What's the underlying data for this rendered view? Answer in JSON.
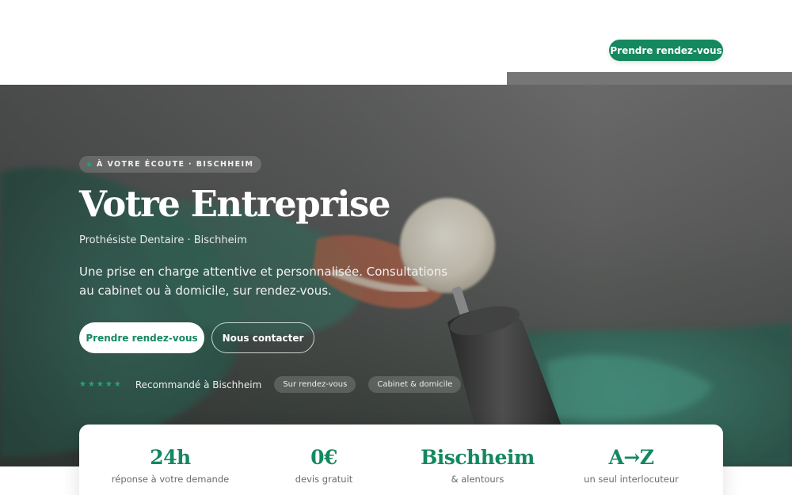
{
  "header": {
    "cta_label": "Prendre rendez-vous"
  },
  "hero": {
    "badge": "À VOTRE ÉCOUTE · BISCHHEIM",
    "title": "Votre Entreprise",
    "subtitle": "Prothésiste Dentaire · Bischheim",
    "description": "Une prise en charge attentive et personnalisée. Consultations au cabinet ou à domicile, sur rendez-vous.",
    "primary_button": "Prendre rendez-vous",
    "secondary_button": "Nous contacter",
    "rating_stars": "★★★★★",
    "rating_value": 5,
    "recommended": "Recommandé à Bischheim",
    "pills": [
      "Sur rendez-vous",
      "Cabinet & domicile"
    ],
    "image": "dental prosthesis polishing photo"
  },
  "stats": [
    {
      "value": "24h",
      "label": "réponse à votre demande"
    },
    {
      "value": "0€",
      "label": "devis gratuit"
    },
    {
      "value": "Bischheim",
      "label": "& alentours"
    },
    {
      "value": "A→Z",
      "label": "un seul interlocuteur"
    }
  ],
  "colors": {
    "accent": "#14885f",
    "hero_dark": "#39403c",
    "text_light": "#ffffff"
  }
}
